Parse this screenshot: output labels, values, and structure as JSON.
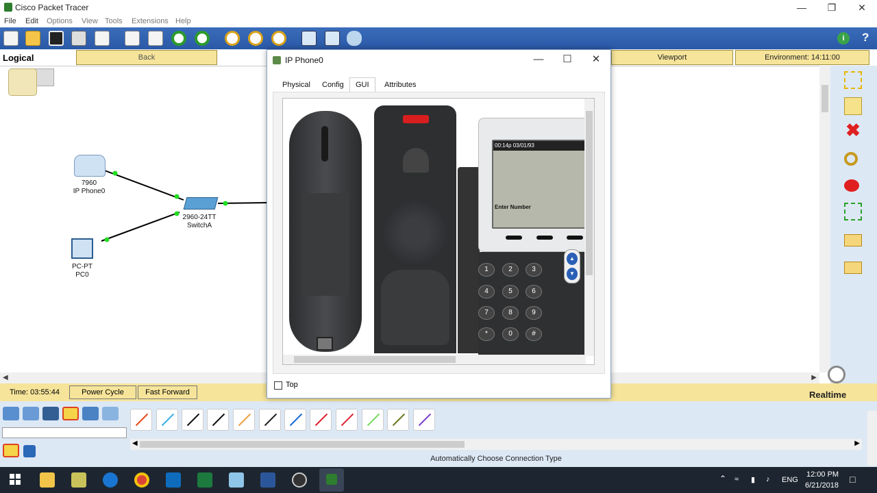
{
  "window": {
    "title": "Cisco Packet Tracer",
    "minimize": "—",
    "restore": "❐",
    "close": "✕"
  },
  "menu": [
    "File",
    "Edit",
    "Options",
    "View",
    "Tools",
    "Extensions",
    "Help"
  ],
  "workspace": {
    "logical": "Logical",
    "back": "Back",
    "viewport": "Viewport",
    "environment": "Environment: 14:11:00"
  },
  "devices": {
    "phone": {
      "model": "7960",
      "name": "IP Phone0"
    },
    "switch": {
      "model": "2960-24TT",
      "name": "SwitchA"
    },
    "pc": {
      "model": "PC-PT",
      "name": "PC0"
    }
  },
  "status": {
    "time": "Time: 03:55:44",
    "power_cycle": "Power Cycle Devices",
    "fast_forward": "Fast Forward Time",
    "mode": "Realtime"
  },
  "connection_hint": "Automatically Choose Connection Type",
  "dialog": {
    "title": "IP Phone0",
    "tabs": [
      "Physical",
      "Config",
      "GUI",
      "Attributes"
    ],
    "active_tab": "GUI",
    "top_label": "Top",
    "phone_screen": {
      "header": "00:14p 03/01/93",
      "message": "Enter Number"
    },
    "keys": [
      "1",
      "2",
      "3",
      "4",
      "5",
      "6",
      "7",
      "8",
      "9",
      "*",
      "0",
      "#"
    ]
  },
  "taskbar": {
    "language": "ENG",
    "clock_time": "12:00 PM",
    "clock_date": "6/21/2018"
  },
  "icons": {
    "info": "i",
    "help": "?"
  }
}
